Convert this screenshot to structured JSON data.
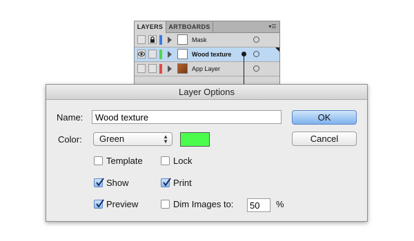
{
  "layers_panel": {
    "tabs": [
      {
        "label": "LAYERS",
        "active": true
      },
      {
        "label": "ARTBOARDS",
        "active": false
      }
    ],
    "menu_icon": "panel-menu-icon",
    "layers": [
      {
        "name": "Mask",
        "visible": false,
        "locked": true,
        "color": "#3b7be0",
        "selected": false
      },
      {
        "name": "Wood texture",
        "visible": true,
        "locked": false,
        "color": "#4cd94c",
        "selected": true
      },
      {
        "name": "App Layer",
        "visible": false,
        "locked": false,
        "color": "#e04848",
        "selected": false
      }
    ]
  },
  "dialog": {
    "title": "Layer Options",
    "name_label": "Name:",
    "name_value": "Wood texture",
    "color_label": "Color:",
    "color_value": "Green",
    "swatch_color": "#4cfc4c",
    "ok_label": "OK",
    "cancel_label": "Cancel",
    "options": {
      "template": {
        "label": "Template",
        "checked": false
      },
      "lock": {
        "label": "Lock",
        "checked": false
      },
      "show": {
        "label": "Show",
        "checked": true
      },
      "print": {
        "label": "Print",
        "checked": true
      },
      "preview": {
        "label": "Preview",
        "checked": true
      },
      "dim": {
        "label": "Dim Images to:",
        "checked": false
      }
    },
    "dim_value": "50",
    "dim_unit": "%"
  }
}
